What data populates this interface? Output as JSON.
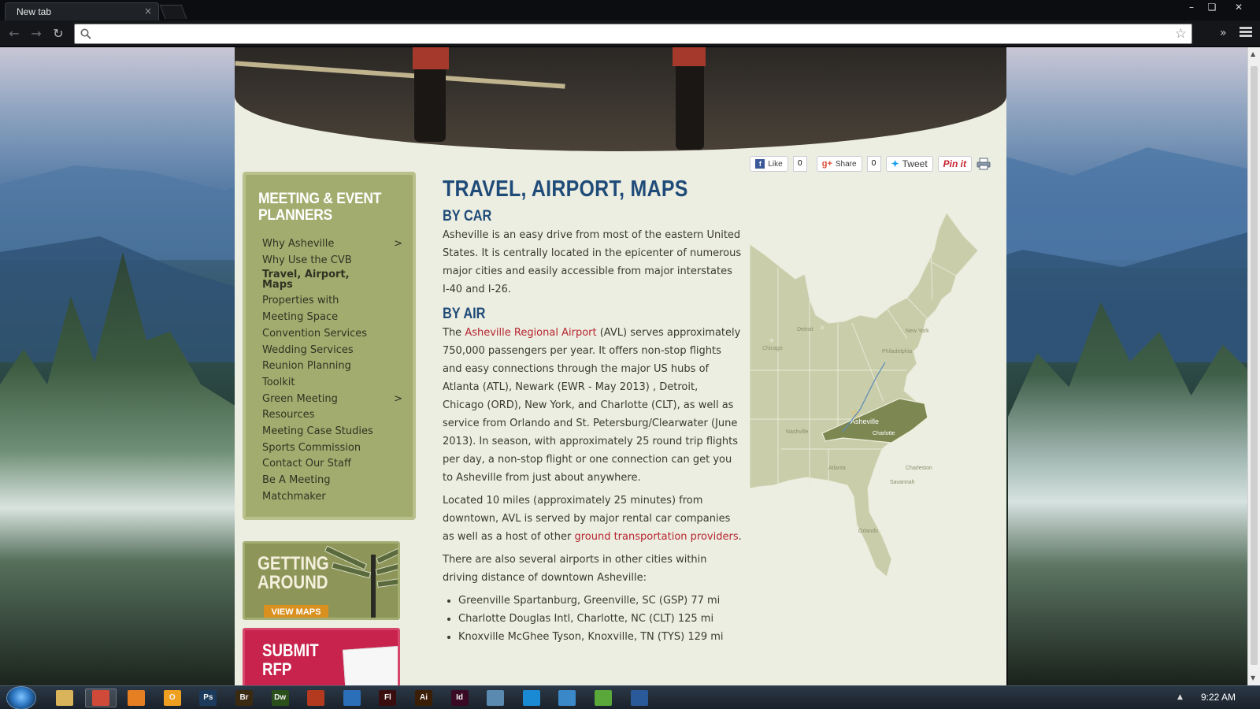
{
  "browser": {
    "tab_title": "New tab",
    "tab_close": "×",
    "omnibox_value": "",
    "window_controls": [
      "minimize",
      "restore",
      "close"
    ]
  },
  "page": {
    "social": {
      "like_label": "Like",
      "like_count": "0",
      "share_label": "Share",
      "share_count": "0",
      "tweet_label": "Tweet",
      "pin_label": "Pin it"
    },
    "sidebar": {
      "heading": "MEETING & EVENT PLANNERS",
      "items": [
        {
          "label": "Why Asheville",
          "chevron": ">"
        },
        {
          "label": "Why Use the CVB"
        },
        {
          "label": "Travel, Airport, Maps",
          "active": true
        },
        {
          "label": "Properties with"
        },
        {
          "label": "Meeting Space"
        },
        {
          "label": "Convention Services"
        },
        {
          "label": "Wedding Services"
        },
        {
          "label": "Reunion Planning"
        },
        {
          "label": "Toolkit"
        },
        {
          "label": "Green Meeting",
          "chevron": ">"
        },
        {
          "label": "Resources"
        },
        {
          "label": "Meeting Case Studies"
        },
        {
          "label": "Sports Commission"
        },
        {
          "label": "Contact Our Staff"
        },
        {
          "label": "Be A Meeting"
        },
        {
          "label": "Matchmaker"
        }
      ]
    },
    "promo": {
      "line1": "GETTING",
      "line2": "AROUND",
      "cta": "VIEW MAPS"
    },
    "promo2": {
      "line1": "SUBMIT",
      "line2": "RFP"
    },
    "content": {
      "title": "TRAVEL, AIRPORT, MAPS",
      "by_car_heading": "BY CAR",
      "by_car_text": "Asheville is an easy drive from most of the eastern United States. It is centrally located in the epicenter of numerous major cities and easily accessible from major interstates I-40 and I-26.",
      "by_air_heading": "BY AIR",
      "by_air_prefix": "The ",
      "by_air_link": "Asheville Regional Airport",
      "by_air_text": " (AVL) serves approximately 750,000 passengers per year. It offers non-stop flights and easy connections through the major US hubs of Atlanta (ATL), Newark (EWR - May 2013) , Detroit, Chicago (ORD), New York, and Charlotte (CLT), as well as service from Orlando and St. Petersburg/Clearwater (June 2013). In season, with approximately 25 round trip flights per day, a non-stop flight or one connection can get you to Asheville from just about anywhere.",
      "located_prefix": "Located 10 miles (approximately 25 minutes) from downtown, AVL is served by major rental car companies as well as a host of other ",
      "located_link": "ground transportation providers",
      "located_suffix": ".",
      "airports_intro": "There are also several airports in other cities within driving distance of downtown Asheville:",
      "airports": [
        "Greenville Spartanburg, Greenville, SC (GSP) 77 mi",
        "Charlotte Douglas Intl, Charlotte, NC (CLT) 125 mi",
        "Knoxville McGhee Tyson, Knoxville, TN (TYS) 129 mi"
      ]
    },
    "map_labels": {
      "detroit": "Detroit",
      "chicago": "Chicago",
      "new_york": "New York",
      "philadelphia": "Philadelphia",
      "asheville": "Asheville",
      "charlotte": "Charlotte",
      "nashville": "Nashville",
      "atlanta": "Atlanta",
      "charleston": "Charleston",
      "savannah": "Savannah",
      "orlando": "Orlando"
    }
  },
  "taskbar": {
    "apps": [
      {
        "name": "explorer",
        "glyph": "",
        "color": "#d9b45a"
      },
      {
        "name": "chrome",
        "glyph": "",
        "color": "#d04a3a",
        "active": true
      },
      {
        "name": "firefox",
        "glyph": "",
        "color": "#e67f22"
      },
      {
        "name": "outlook",
        "glyph": "O",
        "color": "#f0a020"
      },
      {
        "name": "photoshop",
        "glyph": "Ps",
        "color": "#1b3a5c"
      },
      {
        "name": "bridge",
        "glyph": "Br",
        "color": "#3b2a12"
      },
      {
        "name": "dreamweaver",
        "glyph": "Dw",
        "color": "#2a4f1a"
      },
      {
        "name": "filezilla",
        "glyph": "",
        "color": "#b33a1f"
      },
      {
        "name": "thunderbird",
        "glyph": "",
        "color": "#2a6fb8"
      },
      {
        "name": "flash",
        "glyph": "Fl",
        "color": "#3a0e0e"
      },
      {
        "name": "illustrator",
        "glyph": "Ai",
        "color": "#3b1e06"
      },
      {
        "name": "indesign",
        "glyph": "Id",
        "color": "#3a0a24"
      },
      {
        "name": "notepad",
        "glyph": "",
        "color": "#5a8ab0"
      },
      {
        "name": "skype",
        "glyph": "",
        "color": "#1a8ad4"
      },
      {
        "name": "itunes",
        "glyph": "",
        "color": "#3a88c8"
      },
      {
        "name": "spotify",
        "glyph": "",
        "color": "#5aa83a"
      },
      {
        "name": "word",
        "glyph": "",
        "color": "#2b5a9a"
      }
    ],
    "clock": "9:22 AM"
  }
}
